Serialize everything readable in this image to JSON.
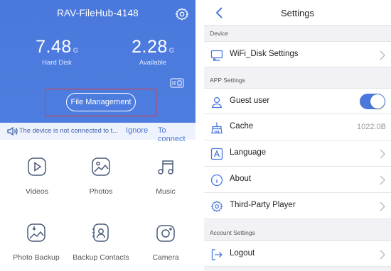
{
  "left": {
    "device_name": "RAV-FileHub-4148",
    "hard_disk": {
      "value": "7.48",
      "unit": "G",
      "label": "Hard Disk"
    },
    "available": {
      "value": "2.28",
      "unit": "G",
      "label": "Available"
    },
    "file_management_label": "File Management",
    "notice": {
      "text": "The device is not connected to t...",
      "ignore_label": "Ignore",
      "connect_label": "To connect"
    },
    "tiles": [
      {
        "label": "Videos"
      },
      {
        "label": "Photos"
      },
      {
        "label": "Music"
      },
      {
        "label": "Photo Backup"
      },
      {
        "label": "Backup Contacts"
      },
      {
        "label": "Camera"
      }
    ]
  },
  "right": {
    "title": "Settings",
    "sections": {
      "device": "Device",
      "app": "APP Settings",
      "account": "Account Settings"
    },
    "rows": {
      "wifi_disk": "WiFi_Disk Settings",
      "guest_user": "Guest user",
      "cache": "Cache",
      "cache_value": "1022.0B",
      "language": "Language",
      "about": "About",
      "third_party": "Third-Party Player",
      "logout": "Logout"
    },
    "guest_user_enabled": true
  },
  "colors": {
    "accent": "#4a78dc",
    "highlight_box": "#e53935",
    "notice_bg": "#eef2fc",
    "settings_bg": "#f2f2f6"
  }
}
